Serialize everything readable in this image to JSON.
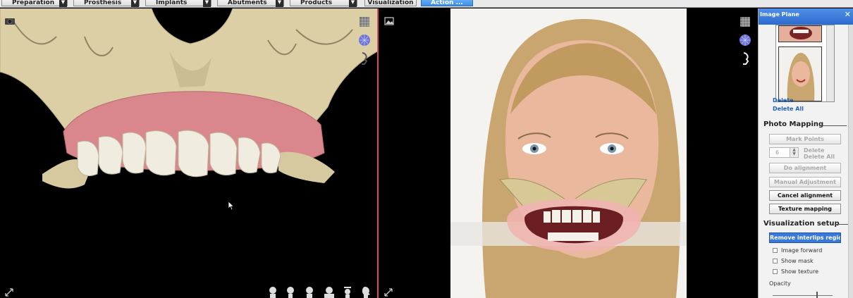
{
  "toolbar": {
    "dropdowns": [
      "Preparation",
      "Prosthesis",
      "Implants",
      "Abutments",
      "Products"
    ],
    "visualization_label": "Visualization ...",
    "action_label": "Action ..."
  },
  "left_viewport": {
    "top_icons": [
      "camera-icon",
      "grid-cube-icon",
      "mesh-sphere-icon",
      "profile-icon"
    ],
    "bottom_icons": [
      "expand-icon",
      "head-front-icon",
      "head-side-icon",
      "head-back-icon",
      "head-top-icon",
      "head-bottom-icon",
      "head-profile-icon"
    ]
  },
  "right_viewport": {
    "top_icons": [
      "image-icon",
      "grid-cube-icon",
      "mesh-sphere-icon",
      "profile-icon"
    ],
    "bottom_icons": [
      "expand-icon"
    ]
  },
  "panel": {
    "title": "Image Plane",
    "delete_label": "Delete",
    "delete_all_label": "Delete All",
    "photo_mapping": {
      "heading": "Photo Mapping",
      "mark_points": "Mark Points",
      "points_value": "6",
      "delete_label": "Delete",
      "delete_all_label": "Delete All",
      "do_alignment": "Do alignment",
      "manual_adjustment": "Manual Adjustment",
      "cancel_alignment": "Cancel alignment",
      "texture_mapping": "Texture mapping"
    },
    "visualization_setup": {
      "heading": "Visualization setup",
      "remove_interlips": "Remove interlips region",
      "checkboxes": [
        "Image forward",
        "Show mask",
        "Show texture"
      ],
      "opacity_label": "Opacity"
    }
  },
  "colors": {
    "accent_blue": "#3a79d8",
    "viewport_divider": "#d84a5a",
    "bone": "#e2d6ad",
    "gum": "#d9878c"
  }
}
